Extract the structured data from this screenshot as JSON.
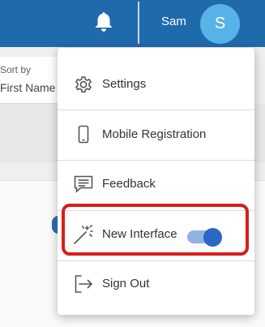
{
  "header": {
    "username": "Sam",
    "avatar_initial": "S",
    "notification_icon": "bell-icon"
  },
  "background": {
    "sort_by_label": "Sort by",
    "sort_by_value": "First Name"
  },
  "menu": {
    "items": [
      {
        "label": "Settings",
        "icon": "gear-icon"
      },
      {
        "label": "Mobile Registration",
        "icon": "mobile-phone-icon"
      },
      {
        "label": "Feedback",
        "icon": "chat-bubble-icon"
      },
      {
        "label": "New Interface",
        "icon": "magic-wand-icon",
        "toggle_on": true
      },
      {
        "label": "Sign Out",
        "icon": "sign-out-icon"
      }
    ]
  },
  "colors": {
    "header_bg": "#1f6aab",
    "avatar_bg": "#57b2e7",
    "toggle_track": "#8eb3df",
    "toggle_knob": "#2c67c3",
    "highlight_border": "#d91c1c"
  }
}
